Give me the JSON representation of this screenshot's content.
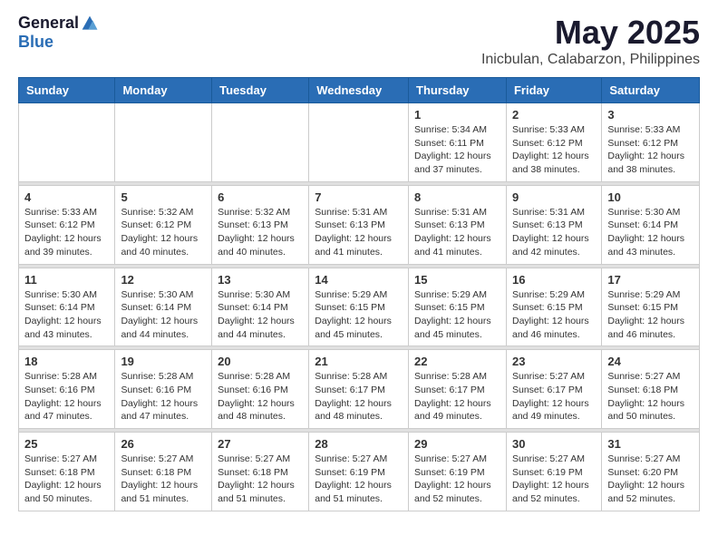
{
  "header": {
    "logo": {
      "general": "General",
      "blue": "Blue"
    },
    "title": "May 2025",
    "subtitle": "Inicbulan, Calabarzon, Philippines"
  },
  "weekdays": [
    "Sunday",
    "Monday",
    "Tuesday",
    "Wednesday",
    "Thursday",
    "Friday",
    "Saturday"
  ],
  "weeks": [
    [
      {
        "day": "",
        "info": ""
      },
      {
        "day": "",
        "info": ""
      },
      {
        "day": "",
        "info": ""
      },
      {
        "day": "",
        "info": ""
      },
      {
        "day": "1",
        "info": "Sunrise: 5:34 AM\nSunset: 6:11 PM\nDaylight: 12 hours and 37 minutes."
      },
      {
        "day": "2",
        "info": "Sunrise: 5:33 AM\nSunset: 6:12 PM\nDaylight: 12 hours and 38 minutes."
      },
      {
        "day": "3",
        "info": "Sunrise: 5:33 AM\nSunset: 6:12 PM\nDaylight: 12 hours and 38 minutes."
      }
    ],
    [
      {
        "day": "4",
        "info": "Sunrise: 5:33 AM\nSunset: 6:12 PM\nDaylight: 12 hours and 39 minutes."
      },
      {
        "day": "5",
        "info": "Sunrise: 5:32 AM\nSunset: 6:12 PM\nDaylight: 12 hours and 40 minutes."
      },
      {
        "day": "6",
        "info": "Sunrise: 5:32 AM\nSunset: 6:13 PM\nDaylight: 12 hours and 40 minutes."
      },
      {
        "day": "7",
        "info": "Sunrise: 5:31 AM\nSunset: 6:13 PM\nDaylight: 12 hours and 41 minutes."
      },
      {
        "day": "8",
        "info": "Sunrise: 5:31 AM\nSunset: 6:13 PM\nDaylight: 12 hours and 41 minutes."
      },
      {
        "day": "9",
        "info": "Sunrise: 5:31 AM\nSunset: 6:13 PM\nDaylight: 12 hours and 42 minutes."
      },
      {
        "day": "10",
        "info": "Sunrise: 5:30 AM\nSunset: 6:14 PM\nDaylight: 12 hours and 43 minutes."
      }
    ],
    [
      {
        "day": "11",
        "info": "Sunrise: 5:30 AM\nSunset: 6:14 PM\nDaylight: 12 hours and 43 minutes."
      },
      {
        "day": "12",
        "info": "Sunrise: 5:30 AM\nSunset: 6:14 PM\nDaylight: 12 hours and 44 minutes."
      },
      {
        "day": "13",
        "info": "Sunrise: 5:30 AM\nSunset: 6:14 PM\nDaylight: 12 hours and 44 minutes."
      },
      {
        "day": "14",
        "info": "Sunrise: 5:29 AM\nSunset: 6:15 PM\nDaylight: 12 hours and 45 minutes."
      },
      {
        "day": "15",
        "info": "Sunrise: 5:29 AM\nSunset: 6:15 PM\nDaylight: 12 hours and 45 minutes."
      },
      {
        "day": "16",
        "info": "Sunrise: 5:29 AM\nSunset: 6:15 PM\nDaylight: 12 hours and 46 minutes."
      },
      {
        "day": "17",
        "info": "Sunrise: 5:29 AM\nSunset: 6:15 PM\nDaylight: 12 hours and 46 minutes."
      }
    ],
    [
      {
        "day": "18",
        "info": "Sunrise: 5:28 AM\nSunset: 6:16 PM\nDaylight: 12 hours and 47 minutes."
      },
      {
        "day": "19",
        "info": "Sunrise: 5:28 AM\nSunset: 6:16 PM\nDaylight: 12 hours and 47 minutes."
      },
      {
        "day": "20",
        "info": "Sunrise: 5:28 AM\nSunset: 6:16 PM\nDaylight: 12 hours and 48 minutes."
      },
      {
        "day": "21",
        "info": "Sunrise: 5:28 AM\nSunset: 6:17 PM\nDaylight: 12 hours and 48 minutes."
      },
      {
        "day": "22",
        "info": "Sunrise: 5:28 AM\nSunset: 6:17 PM\nDaylight: 12 hours and 49 minutes."
      },
      {
        "day": "23",
        "info": "Sunrise: 5:27 AM\nSunset: 6:17 PM\nDaylight: 12 hours and 49 minutes."
      },
      {
        "day": "24",
        "info": "Sunrise: 5:27 AM\nSunset: 6:18 PM\nDaylight: 12 hours and 50 minutes."
      }
    ],
    [
      {
        "day": "25",
        "info": "Sunrise: 5:27 AM\nSunset: 6:18 PM\nDaylight: 12 hours and 50 minutes."
      },
      {
        "day": "26",
        "info": "Sunrise: 5:27 AM\nSunset: 6:18 PM\nDaylight: 12 hours and 51 minutes."
      },
      {
        "day": "27",
        "info": "Sunrise: 5:27 AM\nSunset: 6:18 PM\nDaylight: 12 hours and 51 minutes."
      },
      {
        "day": "28",
        "info": "Sunrise: 5:27 AM\nSunset: 6:19 PM\nDaylight: 12 hours and 51 minutes."
      },
      {
        "day": "29",
        "info": "Sunrise: 5:27 AM\nSunset: 6:19 PM\nDaylight: 12 hours and 52 minutes."
      },
      {
        "day": "30",
        "info": "Sunrise: 5:27 AM\nSunset: 6:19 PM\nDaylight: 12 hours and 52 minutes."
      },
      {
        "day": "31",
        "info": "Sunrise: 5:27 AM\nSunset: 6:20 PM\nDaylight: 12 hours and 52 minutes."
      }
    ]
  ]
}
